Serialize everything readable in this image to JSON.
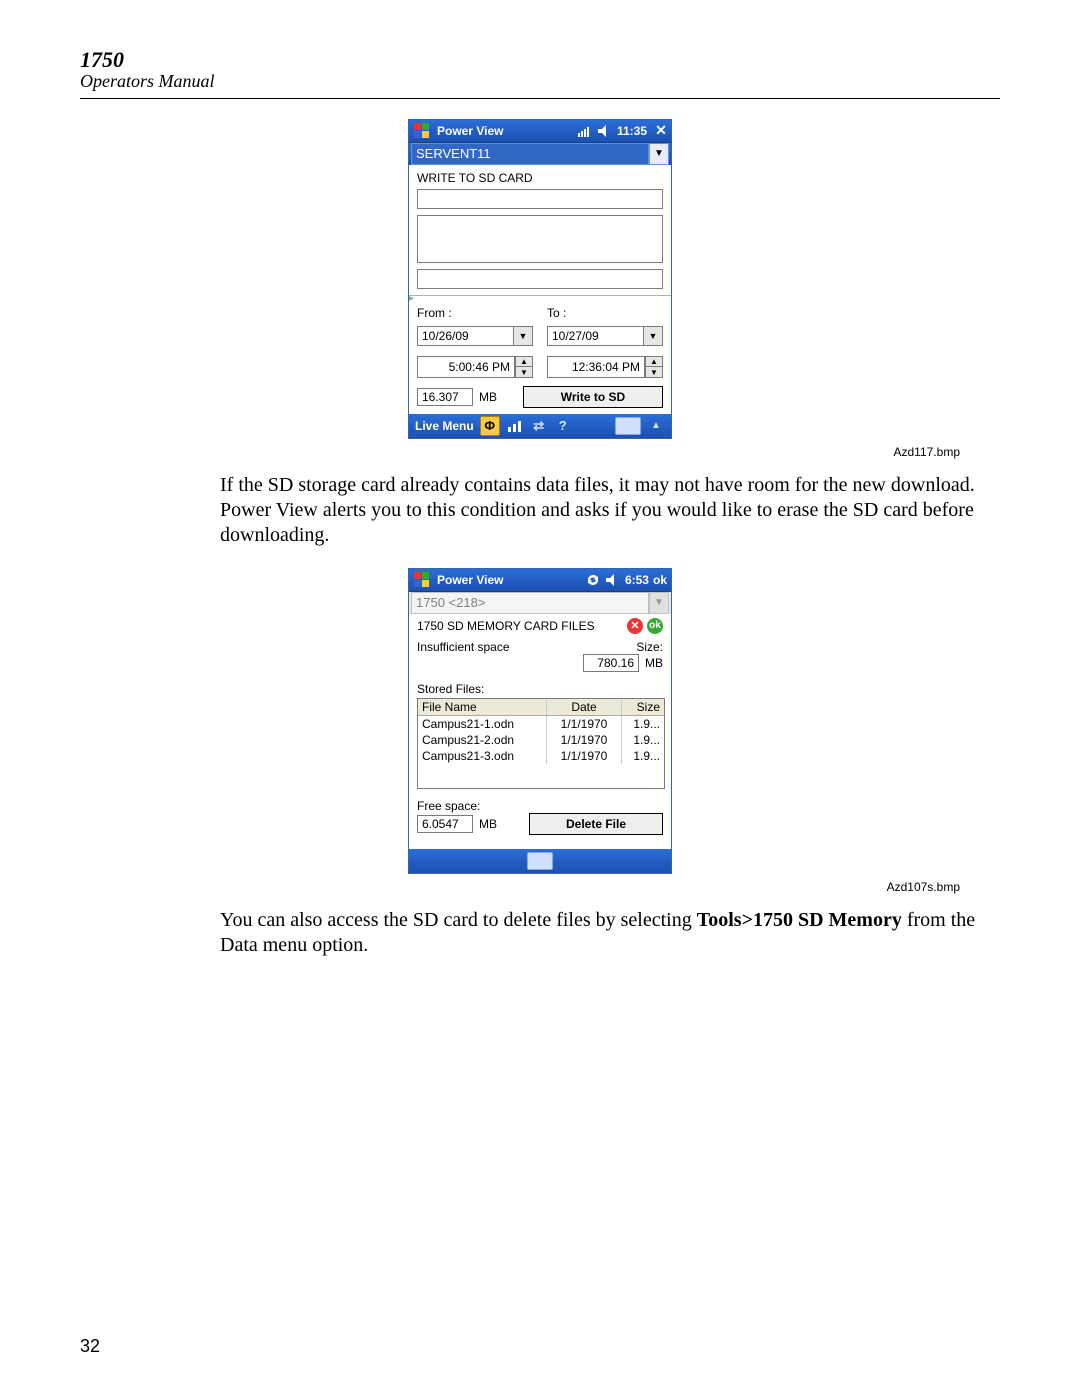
{
  "header": {
    "model": "1750",
    "subtitle": "Operators Manual"
  },
  "page_number": "32",
  "caption1": "Azd117.bmp",
  "caption2": "Azd107s.bmp",
  "para1": "If the SD storage card already contains data files, it may not have room for the new download. Power View alerts you to this condition and asks if you would like to erase the SD card before downloading.",
  "para2_pre": "You can also access the SD card to delete files by selecting ",
  "para2_bold": "Tools>1750 SD Memory",
  "para2_post": " from the Data menu option.",
  "shot1": {
    "titlebar": {
      "title": "Power View",
      "time": "11:35"
    },
    "device_name": "SERVENT11",
    "section": "WRITE TO SD CARD",
    "from_label": "From :",
    "to_label": "To :",
    "from_date": "10/26/09",
    "to_date": "10/27/09",
    "from_time": "5:00:46 PM",
    "to_time": "12:36:04 PM",
    "size_value": "16.307",
    "size_unit": "MB",
    "write_btn": "Write to SD",
    "bottom_menu": "Live Menu"
  },
  "shot2": {
    "titlebar": {
      "title": "Power View",
      "time": "6:53",
      "ok": "ok"
    },
    "device_name": "1750 <218>",
    "header_text": "1750 SD MEMORY CARD FILES",
    "msg": "Insufficient space",
    "size_label": "Size:",
    "size_value": "780.16",
    "size_unit": "MB",
    "stored_label": "Stored Files:",
    "cols": {
      "name": "File Name",
      "date": "Date",
      "size": "Size"
    },
    "rows": [
      {
        "name": "Campus21-1.odn",
        "date": "1/1/1970",
        "size": "1.9..."
      },
      {
        "name": "Campus21-2.odn",
        "date": "1/1/1970",
        "size": "1.9..."
      },
      {
        "name": "Campus21-3.odn",
        "date": "1/1/1970",
        "size": "1.9..."
      }
    ],
    "free_label": "Free space:",
    "free_value": "6.0547",
    "free_unit": "MB",
    "delete_btn": "Delete File"
  }
}
